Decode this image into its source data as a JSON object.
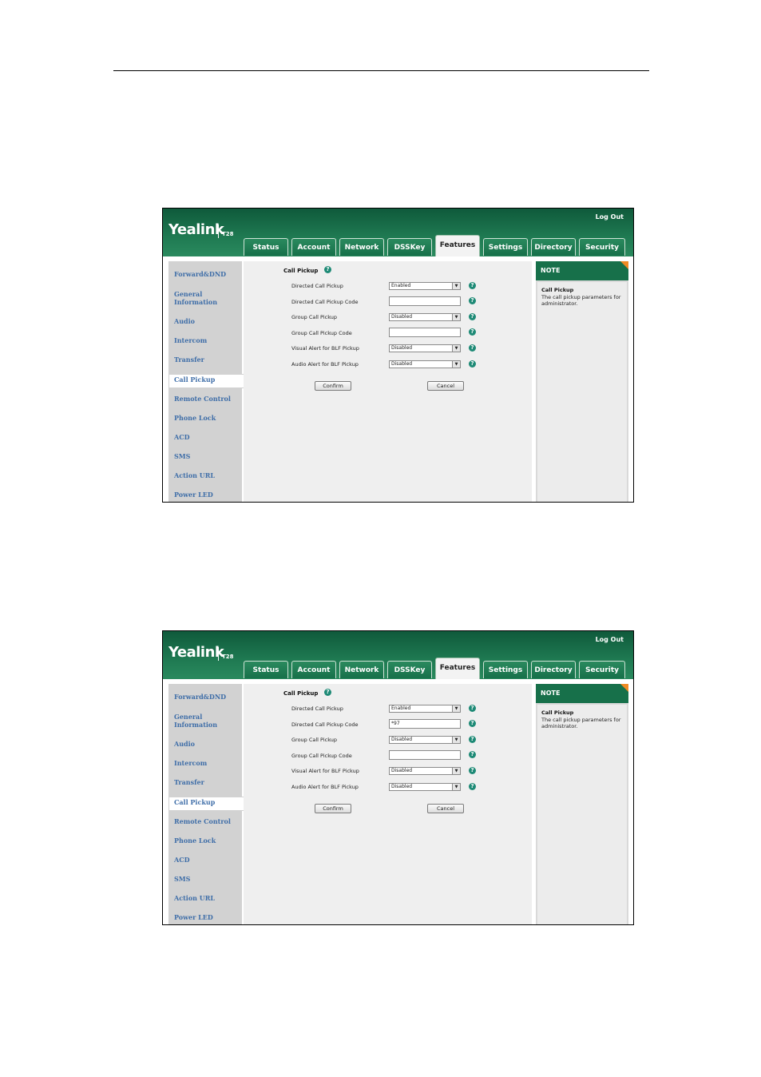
{
  "app": {
    "brand": "Yealink",
    "model": "T28",
    "logout": "Log Out"
  },
  "tabs": [
    "Status",
    "Account",
    "Network",
    "DSSKey",
    "Features",
    "Settings",
    "Directory",
    "Security"
  ],
  "active_tab": "Features",
  "sidebar": [
    "Forward&DND",
    "General Information",
    "Audio",
    "Intercom",
    "Transfer",
    "Call Pickup",
    "Remote Control",
    "Phone Lock",
    "ACD",
    "SMS",
    "Action URL",
    "Power LED"
  ],
  "active_sidebar": "Call Pickup",
  "section_title": "Call Pickup",
  "field_labels": {
    "directed": "Directed Call Pickup",
    "directed_code": "Directed Call Pickup Code",
    "group": "Group Call Pickup",
    "group_code": "Group Call Pickup Code",
    "visual": "Visual Alert for BLF Pickup",
    "audio": "Audio Alert for BLF Pickup"
  },
  "buttons": {
    "confirm": "Confirm",
    "cancel": "Cancel"
  },
  "note": {
    "header": "NOTE",
    "title": "Call Pickup",
    "text": "The call pickup parameters for administrator."
  },
  "colors": {
    "header_green": "#17704a",
    "note_accent": "#f08a24",
    "link_blue": "#3f6ea8"
  },
  "screenshots": [
    {
      "values": {
        "directed": "Enabled",
        "directed_code": "",
        "group": "Disabled",
        "group_code": "",
        "visual": "Disabled",
        "audio": "Disabled"
      }
    },
    {
      "values": {
        "directed": "Enabled",
        "directed_code": "*97",
        "group": "Disabled",
        "group_code": "",
        "visual": "Disabled",
        "audio": "Disabled"
      }
    }
  ]
}
